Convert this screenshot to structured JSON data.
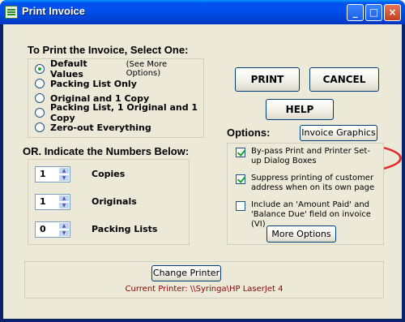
{
  "window": {
    "title": "Print Invoice",
    "controls": {
      "minimize": "_",
      "maximize": "□",
      "close": "×"
    }
  },
  "select_group": {
    "title": "To Print the Invoice, Select One:",
    "options": [
      {
        "label": "Default Values",
        "hint": "(See More Options)",
        "checked": true
      },
      {
        "label": "Packing List Only",
        "hint": "",
        "checked": false
      },
      {
        "label": "Original and 1 Copy",
        "hint": "",
        "checked": false
      },
      {
        "label": "Packing List, 1 Original and 1 Copy",
        "hint": "",
        "checked": false
      },
      {
        "label": "Zero-out Everything",
        "hint": "",
        "checked": false
      }
    ]
  },
  "numbers_group": {
    "title": "OR. Indicate the Numbers Below:",
    "fields": [
      {
        "value": "1",
        "label": "Copies"
      },
      {
        "value": "1",
        "label": "Originals"
      },
      {
        "value": "0",
        "label": "Packing Lists"
      }
    ]
  },
  "buttons": {
    "print": "PRINT",
    "cancel": "CANCEL",
    "help": "HELP",
    "invoice_graphics": "Invoice Graphics",
    "more_options": "More Options",
    "change_printer": "Change Printer"
  },
  "options_group": {
    "title": "Options:",
    "items": [
      {
        "label": "By-pass Print and Printer Set-up Dialog Boxes",
        "checked": true
      },
      {
        "label": "Suppress printing of customer address when on its own page",
        "checked": true
      },
      {
        "label": "Include an 'Amount Paid' and 'Balance Due' field on invoice (VI)",
        "checked": false
      }
    ]
  },
  "printer": {
    "current": "Current Printer: \\\\Syringa\\HP LaserJet 4"
  },
  "colors": {
    "titlebar": "#0050ee",
    "dialog_bg": "#ece9d8",
    "highlight_ring": "#e42a2a",
    "printer_text": "#8b0000"
  }
}
